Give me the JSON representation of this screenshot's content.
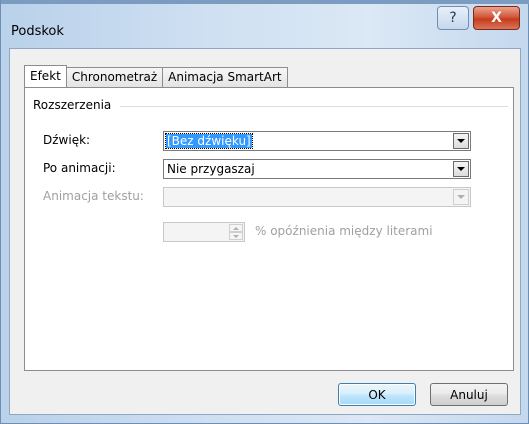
{
  "window": {
    "title": "Podskok",
    "help_label": "?",
    "close_label": "X"
  },
  "tabs": [
    {
      "label": "Efekt",
      "active": true
    },
    {
      "label": "Chronometraż",
      "active": false
    },
    {
      "label": "Animacja SmartArt",
      "active": false
    }
  ],
  "group": {
    "label": "Rozszerzenia"
  },
  "sound": {
    "label": "Dźwięk:",
    "value": "[Bez dźwięku]"
  },
  "after_animation": {
    "label": "Po animacji:",
    "value": "Nie przygaszaj"
  },
  "animate_text": {
    "label": "Animacja tekstu:",
    "value": "",
    "enabled": false
  },
  "delay": {
    "value": "",
    "label": "% opóźnienia między literami",
    "enabled": false
  },
  "buttons": {
    "ok": "OK",
    "cancel": "Anuluj"
  },
  "icons": {
    "sound": "speaker-icon"
  },
  "colors": {
    "selection": "#3399ff",
    "close_button": "#c53c1c"
  }
}
